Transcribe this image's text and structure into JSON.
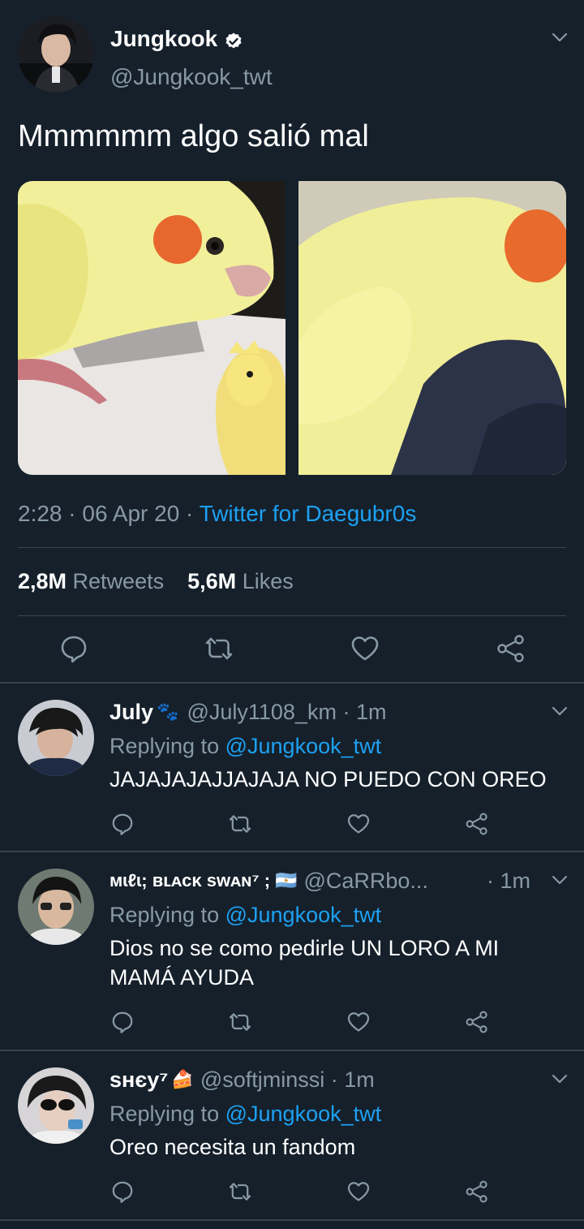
{
  "main_tweet": {
    "name": "Jungkook",
    "handle": "@Jungkook_twt",
    "text": "Mmmmmm algo salió mal",
    "time": "2:28",
    "date": "06 Apr 20",
    "source": "Twitter for Daegubr0s",
    "retweets_count": "2,8M",
    "retweets_label": "Retweets",
    "likes_count": "5,6M",
    "likes_label": "Likes"
  },
  "icons": {
    "verified": "verified-badge-icon",
    "reply": "reply-icon",
    "retweet": "retweet-icon",
    "like": "heart-icon",
    "share": "share-icon",
    "menu": "chevron-down-icon"
  },
  "replies": [
    {
      "name": "July",
      "name_emoji": "🐾",
      "handle": "@July1108_km",
      "time": "1m",
      "replying_prefix": "Replying to",
      "replying_to": "@Jungkook_twt",
      "text": "JAJAJAJAJJAJAJA NO PUEDO CON OREO"
    },
    {
      "name": "ᴍɩℓɩ; ʙʟᴀᴄᴋ sᴡᴀɴ⁷ ;",
      "name_emoji": "🇦🇷",
      "handle": "@CaRRbo...",
      "time": "1m",
      "replying_prefix": "Replying to",
      "replying_to": "@Jungkook_twt",
      "text": "Dios no se como pedirle UN LORO A MI MAMÁ AYUDA"
    },
    {
      "name": "sʜєу⁷",
      "name_emoji": "🍰",
      "handle": "@softjminssi",
      "time": "1m",
      "replying_prefix": "Replying to",
      "replying_to": "@Jungkook_twt",
      "text": "Oreo necesita un fandom"
    }
  ],
  "colors": {
    "background": "#15202b",
    "text": "#ffffff",
    "muted": "#8899a6",
    "accent": "#1da1f2",
    "divider": "#38444d"
  }
}
